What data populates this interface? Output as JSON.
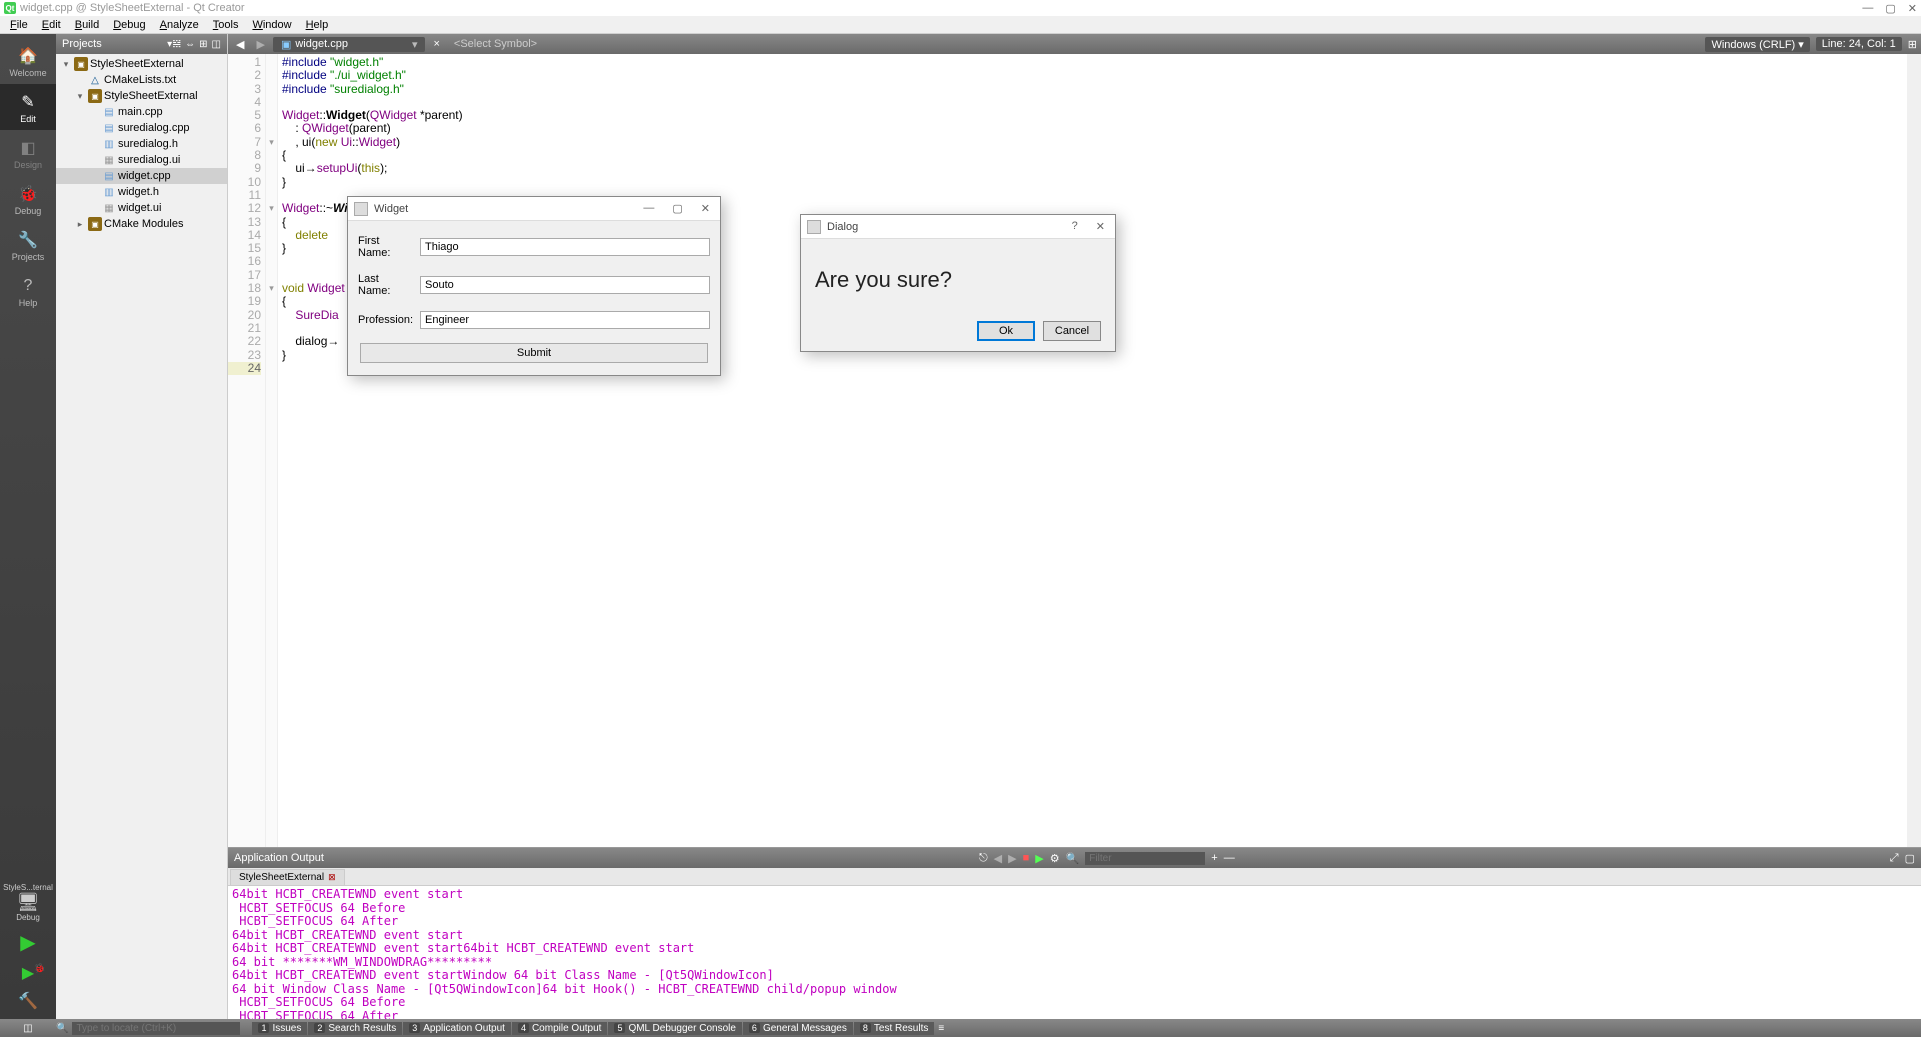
{
  "window": {
    "title": "widget.cpp @ StyleSheetExternal - Qt Creator",
    "min": "—",
    "max": "▢",
    "close": "✕"
  },
  "menu": {
    "file": "File",
    "edit": "Edit",
    "build": "Build",
    "debug": "Debug",
    "analyze": "Analyze",
    "tools": "Tools",
    "window": "Window",
    "help": "Help"
  },
  "rail": {
    "welcome": "Welcome",
    "edit": "Edit",
    "design": "Design",
    "debug": "Debug",
    "projects": "Projects",
    "help": "Help",
    "kit": "StyleS...ternal",
    "kit_mode": "Debug"
  },
  "projects": {
    "header": "Projects",
    "items": [
      {
        "indent": 0,
        "arrow": "▾",
        "icon": "proj",
        "label": "StyleSheetExternal"
      },
      {
        "indent": 1,
        "arrow": "",
        "icon": "cmake",
        "label": "CMakeLists.txt"
      },
      {
        "indent": 1,
        "arrow": "▾",
        "icon": "proj",
        "label": "StyleSheetExternal"
      },
      {
        "indent": 2,
        "arrow": "",
        "icon": "cpp",
        "label": "main.cpp"
      },
      {
        "indent": 2,
        "arrow": "",
        "icon": "cpp",
        "label": "suredialog.cpp"
      },
      {
        "indent": 2,
        "arrow": "",
        "icon": "h",
        "label": "suredialog.h"
      },
      {
        "indent": 2,
        "arrow": "",
        "icon": "ui",
        "label": "suredialog.ui"
      },
      {
        "indent": 2,
        "arrow": "",
        "icon": "cpp",
        "label": "widget.cpp",
        "sel": true
      },
      {
        "indent": 2,
        "arrow": "",
        "icon": "h",
        "label": "widget.h"
      },
      {
        "indent": 2,
        "arrow": "",
        "icon": "ui",
        "label": "widget.ui"
      },
      {
        "indent": 1,
        "arrow": "▸",
        "icon": "proj",
        "label": "CMake Modules"
      }
    ]
  },
  "editor_toolbar": {
    "back": "◀",
    "fwd": "▶",
    "file": "widget.cpp",
    "file_close": "×",
    "symbol": "<Select Symbol>",
    "encoding": "Windows (CRLF)",
    "pos": "Line: 24, Col: 1"
  },
  "code": {
    "lines": [
      {
        "n": 1,
        "html": "<span class='pp'>#include</span> <span class='str'>\"widget.h\"</span>"
      },
      {
        "n": 2,
        "html": "<span class='pp'>#include</span> <span class='str'>\"./ui_widget.h\"</span>"
      },
      {
        "n": 3,
        "html": "<span class='pp'>#include</span> <span class='str'>\"suredialog.h\"</span>"
      },
      {
        "n": 4,
        "html": ""
      },
      {
        "n": 5,
        "html": "<span class='ty'>Widget</span>::<b>Widget</b>(<span class='ty'>QWidget</span> *parent)"
      },
      {
        "n": 6,
        "html": "    : <span class='ty'>QWidget</span>(parent)"
      },
      {
        "n": 7,
        "fold": "▾",
        "html": "    , ui(<span class='kw'>new</span> <span class='ty'>Ui</span>::<span class='ty'>Widget</span>)"
      },
      {
        "n": 8,
        "html": "{"
      },
      {
        "n": 9,
        "html": "    ui→<span class='ty'>setupUi</span>(<span class='kw'>this</span>);"
      },
      {
        "n": 10,
        "html": "}"
      },
      {
        "n": 11,
        "html": ""
      },
      {
        "n": 12,
        "fold": "▾",
        "html": "<span class='ty'>Widget</span>::~<b><i>Wi</i></b>"
      },
      {
        "n": 13,
        "html": "{"
      },
      {
        "n": 14,
        "html": "    <span class='kw'>delete</span>"
      },
      {
        "n": 15,
        "html": "}"
      },
      {
        "n": 16,
        "html": ""
      },
      {
        "n": 17,
        "html": ""
      },
      {
        "n": 18,
        "fold": "▾",
        "html": "<span class='kw'>void</span> <span class='ty'>Widget</span>"
      },
      {
        "n": 19,
        "html": "{"
      },
      {
        "n": 20,
        "html": "    <span class='ty'>SureDia</span>"
      },
      {
        "n": 21,
        "html": ""
      },
      {
        "n": 22,
        "html": "    dialog→"
      },
      {
        "n": 23,
        "html": "}"
      },
      {
        "n": 24,
        "cur": true,
        "html": ""
      }
    ]
  },
  "output": {
    "title": "Application Output",
    "filter_ph": "Filter",
    "tab": "StyleSheetExternal",
    "lines": [
      "64bit HCBT_CREATEWND event start",
      " HCBT_SETFOCUS 64 Before",
      " HCBT_SETFOCUS 64 After",
      "64bit HCBT_CREATEWND event start",
      "64bit HCBT_CREATEWND event start64bit HCBT_CREATEWND event start",
      "64 bit *******WM_WINDOWDRAG*********",
      "64bit HCBT_CREATEWND event startWindow 64 bit Class Name - [Qt5QWindowIcon]",
      "64 bit Window Class Name - [Qt5QWindowIcon]64 bit Hook() - HCBT_CREATEWND child/popup window",
      " HCBT_SETFOCUS 64 Before",
      " HCBT_SETFOCUS 64 After"
    ]
  },
  "statusbar": {
    "locate_ph": "Type to locate (Ctrl+K)",
    "tabs": [
      {
        "n": "1",
        "label": "Issues"
      },
      {
        "n": "2",
        "label": "Search Results"
      },
      {
        "n": "3",
        "label": "Application Output"
      },
      {
        "n": "4",
        "label": "Compile Output"
      },
      {
        "n": "5",
        "label": "QML Debugger Console"
      },
      {
        "n": "6",
        "label": "General Messages"
      },
      {
        "n": "8",
        "label": "Test Results"
      }
    ]
  },
  "widget_dialog": {
    "title": "Widget",
    "first_label": "First Name:",
    "first_value": "Thiago",
    "last_label": "Last Name:",
    "last_value": "Souto",
    "prof_label": "Profession:",
    "prof_value": "Engineer",
    "submit": "Submit",
    "min": "—",
    "max": "▢",
    "close": "✕"
  },
  "confirm_dialog": {
    "title": "Dialog",
    "msg": "Are you sure?",
    "ok": "Ok",
    "cancel": "Cancel",
    "help": "?",
    "close": "✕"
  }
}
